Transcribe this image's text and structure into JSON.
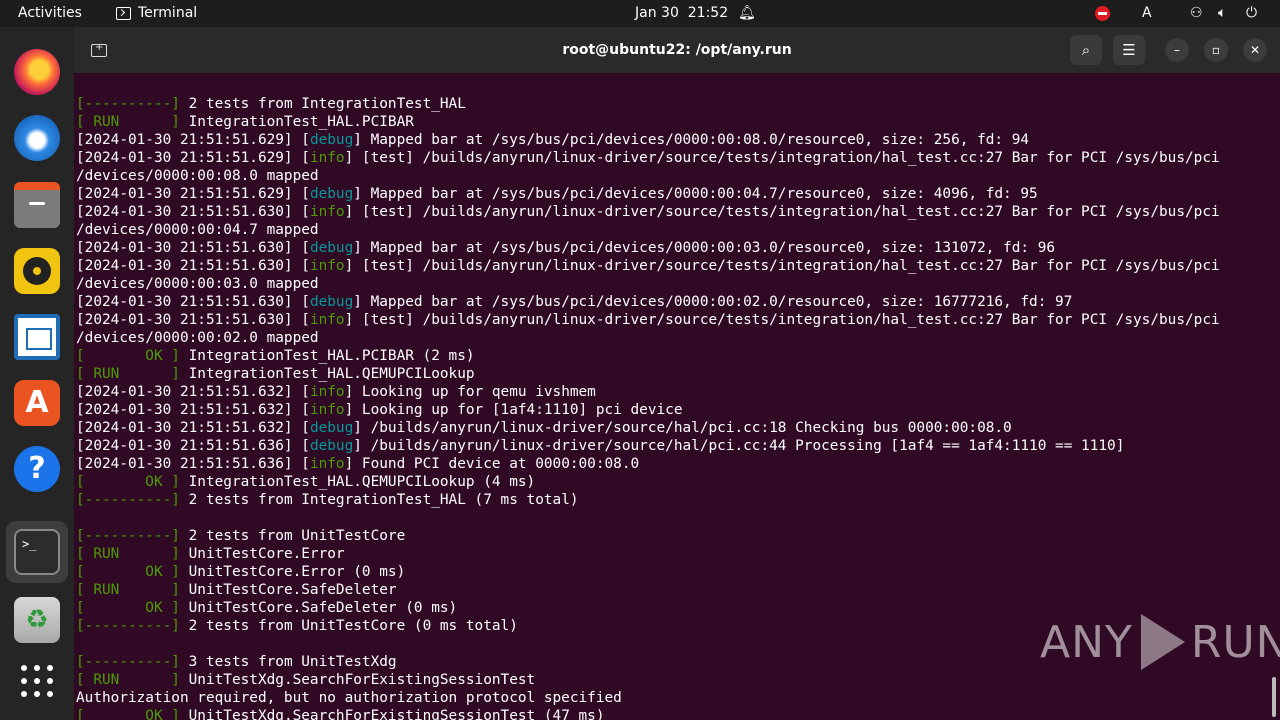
{
  "topbar": {
    "activities": "Activities",
    "app_name": "Terminal",
    "date": "Jan 30",
    "time": "21:52",
    "lang": "A",
    "icons": [
      "terminal-icon",
      "bell-icon",
      "recording-icon",
      "network-icon",
      "volume-icon",
      "power-icon"
    ]
  },
  "dock": {
    "apps": [
      "firefox",
      "thunderbird",
      "files",
      "rhythmbox",
      "libreoffice-writer",
      "ubuntu-software",
      "help",
      "terminal",
      "trash",
      "show-applications"
    ],
    "terminal_glyph": ">_",
    "help_glyph": "?",
    "software_glyph": "A",
    "trash_glyph": "♻"
  },
  "window": {
    "title": "root@ubuntu22: /opt/any.run",
    "buttons": {
      "search": "⌕",
      "menu": "☰",
      "minimize": "–",
      "maximize": "▫",
      "close": "✕"
    }
  },
  "terminal": {
    "lines": [
      [
        {
          "t": "[----------] ",
          "c": "g"
        },
        {
          "t": "2 tests from IntegrationTest_HAL"
        }
      ],
      [
        {
          "t": "[ RUN      ] ",
          "c": "g"
        },
        {
          "t": "IntegrationTest_HAL.PCIBAR"
        }
      ],
      [
        {
          "t": "[2024-01-30 21:51:51.629] ["
        },
        {
          "t": "debug",
          "c": "c"
        },
        {
          "t": "] Mapped bar at /sys/bus/pci/devices/0000:00:08.0/resource0, size: 256, fd: 94"
        }
      ],
      [
        {
          "t": "[2024-01-30 21:51:51.629] ["
        },
        {
          "t": "info",
          "c": "g"
        },
        {
          "t": "] [test] /builds/anyrun/linux-driver/source/tests/integration/hal_test.cc:27 Bar for PCI /sys/bus/pci"
        }
      ],
      [
        {
          "t": "/devices/0000:00:08.0 mapped"
        }
      ],
      [
        {
          "t": "[2024-01-30 21:51:51.629] ["
        },
        {
          "t": "debug",
          "c": "c"
        },
        {
          "t": "] Mapped bar at /sys/bus/pci/devices/0000:00:04.7/resource0, size: 4096, fd: 95"
        }
      ],
      [
        {
          "t": "[2024-01-30 21:51:51.630] ["
        },
        {
          "t": "info",
          "c": "g"
        },
        {
          "t": "] [test] /builds/anyrun/linux-driver/source/tests/integration/hal_test.cc:27 Bar for PCI /sys/bus/pci"
        }
      ],
      [
        {
          "t": "/devices/0000:00:04.7 mapped"
        }
      ],
      [
        {
          "t": "[2024-01-30 21:51:51.630] ["
        },
        {
          "t": "debug",
          "c": "c"
        },
        {
          "t": "] Mapped bar at /sys/bus/pci/devices/0000:00:03.0/resource0, size: 131072, fd: 96"
        }
      ],
      [
        {
          "t": "[2024-01-30 21:51:51.630] ["
        },
        {
          "t": "info",
          "c": "g"
        },
        {
          "t": "] [test] /builds/anyrun/linux-driver/source/tests/integration/hal_test.cc:27 Bar for PCI /sys/bus/pci"
        }
      ],
      [
        {
          "t": "/devices/0000:00:03.0 mapped"
        }
      ],
      [
        {
          "t": "[2024-01-30 21:51:51.630] ["
        },
        {
          "t": "debug",
          "c": "c"
        },
        {
          "t": "] Mapped bar at /sys/bus/pci/devices/0000:00:02.0/resource0, size: 16777216, fd: 97"
        }
      ],
      [
        {
          "t": "[2024-01-30 21:51:51.630] ["
        },
        {
          "t": "info",
          "c": "g"
        },
        {
          "t": "] [test] /builds/anyrun/linux-driver/source/tests/integration/hal_test.cc:27 Bar for PCI /sys/bus/pci"
        }
      ],
      [
        {
          "t": "/devices/0000:00:02.0 mapped"
        }
      ],
      [
        {
          "t": "[       OK ] ",
          "c": "g"
        },
        {
          "t": "IntegrationTest_HAL.PCIBAR (2 ms)"
        }
      ],
      [
        {
          "t": "[ RUN      ] ",
          "c": "g"
        },
        {
          "t": "IntegrationTest_HAL.QEMUPCILookup"
        }
      ],
      [
        {
          "t": "[2024-01-30 21:51:51.632] ["
        },
        {
          "t": "info",
          "c": "g"
        },
        {
          "t": "] Looking up for qemu ivshmem"
        }
      ],
      [
        {
          "t": "[2024-01-30 21:51:51.632] ["
        },
        {
          "t": "info",
          "c": "g"
        },
        {
          "t": "] Looking up for [1af4:1110] pci device"
        }
      ],
      [
        {
          "t": "[2024-01-30 21:51:51.632] ["
        },
        {
          "t": "debug",
          "c": "c"
        },
        {
          "t": "] /builds/anyrun/linux-driver/source/hal/pci.cc:18 Checking bus 0000:00:08.0"
        }
      ],
      [
        {
          "t": "[2024-01-30 21:51:51.636] ["
        },
        {
          "t": "debug",
          "c": "c"
        },
        {
          "t": "] /builds/anyrun/linux-driver/source/hal/pci.cc:44 Processing [1af4 == 1af4:1110 == 1110]"
        }
      ],
      [
        {
          "t": "[2024-01-30 21:51:51.636] ["
        },
        {
          "t": "info",
          "c": "g"
        },
        {
          "t": "] Found PCI device at 0000:00:08.0"
        }
      ],
      [
        {
          "t": "[       OK ] ",
          "c": "g"
        },
        {
          "t": "IntegrationTest_HAL.QEMUPCILookup (4 ms)"
        }
      ],
      [
        {
          "t": "[----------] ",
          "c": "g"
        },
        {
          "t": "2 tests from IntegrationTest_HAL (7 ms total)"
        }
      ],
      [],
      [
        {
          "t": "[----------] ",
          "c": "g"
        },
        {
          "t": "2 tests from UnitTestCore"
        }
      ],
      [
        {
          "t": "[ RUN      ] ",
          "c": "g"
        },
        {
          "t": "UnitTestCore.Error"
        }
      ],
      [
        {
          "t": "[       OK ] ",
          "c": "g"
        },
        {
          "t": "UnitTestCore.Error (0 ms)"
        }
      ],
      [
        {
          "t": "[ RUN      ] ",
          "c": "g"
        },
        {
          "t": "UnitTestCore.SafeDeleter"
        }
      ],
      [
        {
          "t": "[       OK ] ",
          "c": "g"
        },
        {
          "t": "UnitTestCore.SafeDeleter (0 ms)"
        }
      ],
      [
        {
          "t": "[----------] ",
          "c": "g"
        },
        {
          "t": "2 tests from UnitTestCore (0 ms total)"
        }
      ],
      [],
      [
        {
          "t": "[----------] ",
          "c": "g"
        },
        {
          "t": "3 tests from UnitTestXdg"
        }
      ],
      [
        {
          "t": "[ RUN      ] ",
          "c": "g"
        },
        {
          "t": "UnitTestXdg.SearchForExistingSessionTest"
        }
      ],
      [
        {
          "t": "Authorization required, but no authorization protocol specified"
        }
      ],
      [
        {
          "t": "[       OK ] ",
          "c": "g"
        },
        {
          "t": "UnitTestXdg.SearchForExistingSessionTest (47 ms)"
        }
      ]
    ]
  },
  "watermark": {
    "left": "ANY",
    "right": "RUN"
  },
  "colors": {
    "background": "#300a24",
    "green": "#4e9a06",
    "cyan": "#06989a",
    "topbar": "#1d1d1d",
    "dock": "#252525",
    "header": "#2a2a2a"
  }
}
